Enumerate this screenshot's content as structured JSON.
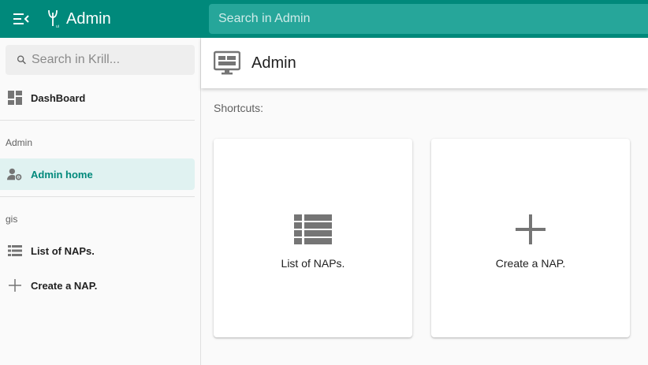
{
  "app": {
    "title": "Admin"
  },
  "top_search": {
    "placeholder": "Search in Admin"
  },
  "sidebar": {
    "search_placeholder": "Search in Krill...",
    "dashboard_label": "DashBoard",
    "section_admin": "Admin",
    "admin_home_label": "Admin home",
    "section_gis": "gis",
    "list_naps_label": "List of NAPs.",
    "create_nap_label": "Create a NAP."
  },
  "main": {
    "title": "Admin",
    "shortcuts_label": "Shortcuts:",
    "cards": [
      {
        "label": "List of NAPs.",
        "icon": "list-icon"
      },
      {
        "label": "Create a NAP.",
        "icon": "plus-icon"
      }
    ]
  },
  "colors": {
    "primary": "#00897b",
    "search_bg": "#26a69a",
    "active_bg": "#e0f2f1",
    "icon_gray": "#757575"
  }
}
